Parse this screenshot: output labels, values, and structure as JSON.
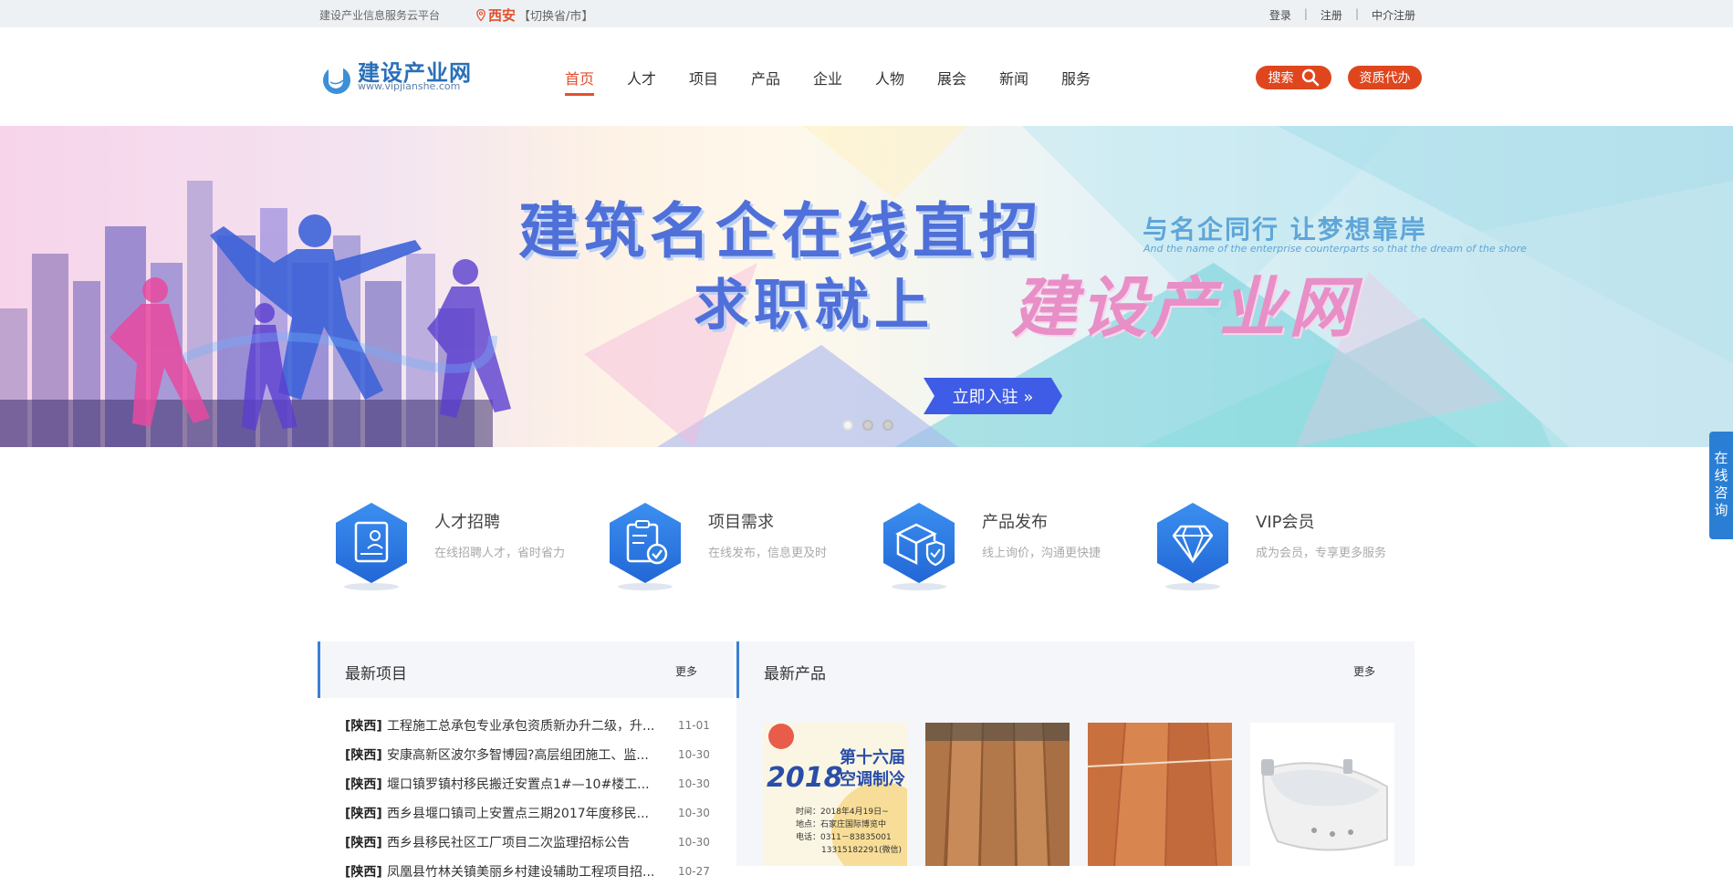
{
  "topbar": {
    "slogan": "建设产业信息服务云平台",
    "city": "西安",
    "switch_label": "【切换省/市】",
    "links": [
      "登录",
      "注册",
      "中介注册"
    ]
  },
  "header": {
    "logo_title": "建设产业网",
    "logo_url": "www.vipjianshe.com",
    "nav": [
      {
        "label": "首页",
        "active": true
      },
      {
        "label": "人才"
      },
      {
        "label": "项目"
      },
      {
        "label": "产品"
      },
      {
        "label": "企业"
      },
      {
        "label": "人物"
      },
      {
        "label": "展会"
      },
      {
        "label": "新闻"
      },
      {
        "label": "服务"
      }
    ],
    "search_label": "搜索",
    "qualification_label": "资质代办"
  },
  "banner": {
    "line1": "建筑名企在线直招",
    "line2": "求职就上",
    "brand": "建设产业网",
    "tagline": "与名企同行 让梦想靠岸",
    "tagline_en": "And the name of the enterprise counterparts so that the dream of the shore",
    "cta": "立即入驻",
    "slides": 3,
    "active_slide": 0
  },
  "consult": {
    "label": "在线咨询"
  },
  "features": [
    {
      "title": "人才招聘",
      "desc": "在线招聘人才，省时省力",
      "icon": "resume-icon"
    },
    {
      "title": "项目需求",
      "desc": "在线发布，信息更及时",
      "icon": "clipboard-check-icon"
    },
    {
      "title": "产品发布",
      "desc": "线上询价，沟通更快捷",
      "icon": "box-shield-icon"
    },
    {
      "title": "VIP会员",
      "desc": "成为会员，专享更多服务",
      "icon": "diamond-icon"
    }
  ],
  "latest_projects": {
    "title": "最新项目",
    "more": "更多",
    "items": [
      {
        "prov": "[陕西]",
        "title": "工程施工总承包专业承包资质新办升二级，升...",
        "date": "11-01"
      },
      {
        "prov": "[陕西]",
        "title": "安康高新区波尔多智博园?高层组团施工、监...",
        "date": "10-30"
      },
      {
        "prov": "[陕西]",
        "title": "堰口镇罗镇村移民搬迁安置点1#—10#楼工...",
        "date": "10-30"
      },
      {
        "prov": "[陕西]",
        "title": "西乡县堰口镇司上安置点三期2017年度移民...",
        "date": "10-30"
      },
      {
        "prov": "[陕西]",
        "title": "西乡县移民社区工厂项目二次监理招标公告",
        "date": "10-30"
      },
      {
        "prov": "[陕西]",
        "title": "凤凰县竹林关镇美丽乡村建设辅助工程项目招...",
        "date": "10-27"
      }
    ]
  },
  "latest_products": {
    "title": "最新产品",
    "more": "更多",
    "items": [
      {
        "kind": "expo-poster",
        "year": "2018",
        "heading": "第十六届",
        "sub": "空调制冷",
        "lines": [
          "时间：2018年4月19日~",
          "地点：石家庄国际博览中",
          "电话：0311－83835001",
          "13315182291(微信)"
        ]
      },
      {
        "kind": "wood-boards-light"
      },
      {
        "kind": "wood-boards-red"
      },
      {
        "kind": "bathtub"
      }
    ]
  },
  "colors": {
    "accent": "#e2502e",
    "blue": "#3a7fd6",
    "hex_blue": "#2f7fe0"
  }
}
